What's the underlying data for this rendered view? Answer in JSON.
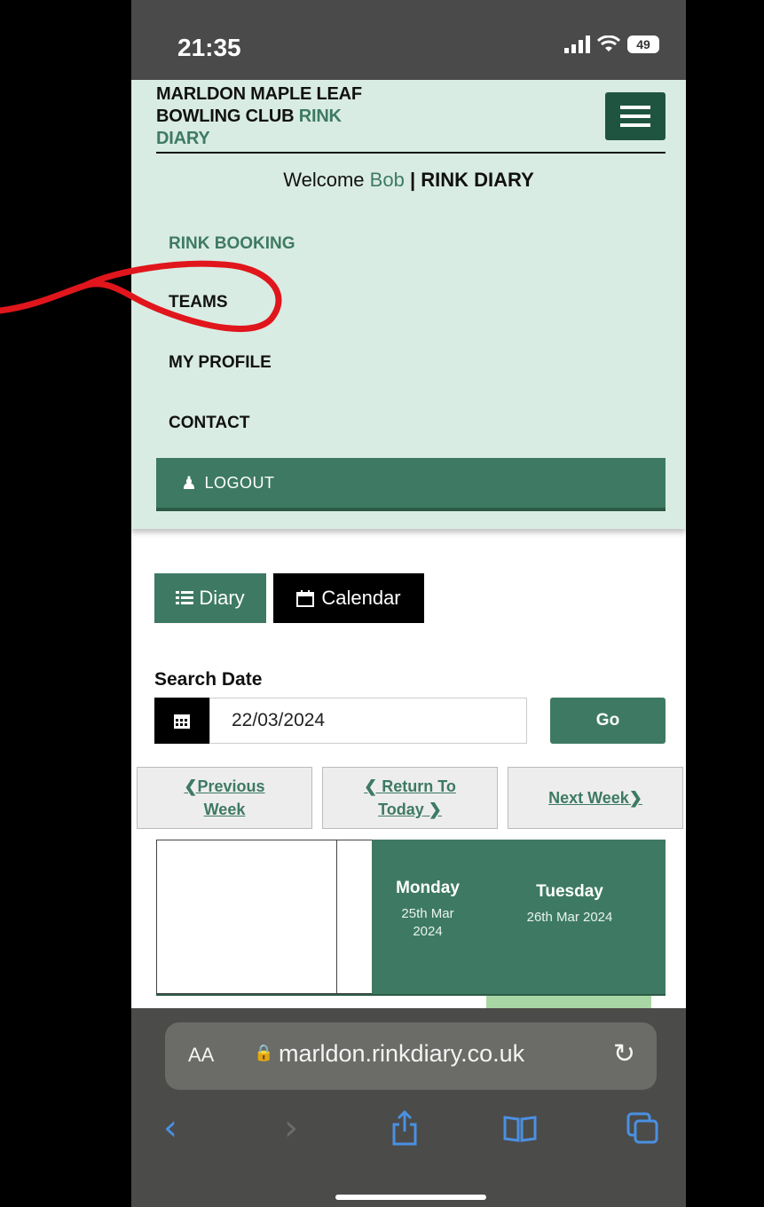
{
  "status": {
    "time": "21:35",
    "battery": "49"
  },
  "header": {
    "brand_line1": "MARLDON MAPLE LEAF",
    "brand_line2": "BOWLING CLUB",
    "brand_accent1": "RINK",
    "brand_accent2": "DIARY",
    "welcome_prefix": "Welcome",
    "user_name": "Bob",
    "separator": "|",
    "section": "RINK DIARY"
  },
  "menu": {
    "items": [
      {
        "label": "RINK BOOKING"
      },
      {
        "label": "TEAMS"
      },
      {
        "label": "MY PROFILE"
      },
      {
        "label": "CONTACT"
      }
    ],
    "logout": "LOGOUT"
  },
  "view_toggle": {
    "diary": "Diary",
    "calendar": "Calendar"
  },
  "search": {
    "label": "Search Date",
    "value": "22/03/2024",
    "go": "Go"
  },
  "week_nav": {
    "prev_line1": "Previous",
    "prev_line2": "Week",
    "today_line1": "Return To",
    "today_line2": "Today",
    "next": "Next Week"
  },
  "diary_header": [
    {
      "day": "Monday",
      "date_line1": "25th Mar",
      "date_line2": "2024"
    },
    {
      "day": "Tuesday",
      "date_line1": "26th Mar 2024"
    }
  ],
  "browser": {
    "aa": "AA",
    "url": "marldon.rinkdiary.co.uk"
  },
  "colors": {
    "accent": "#3e7a63",
    "panel": "#d9ece3",
    "annotation": "#e0161c"
  }
}
